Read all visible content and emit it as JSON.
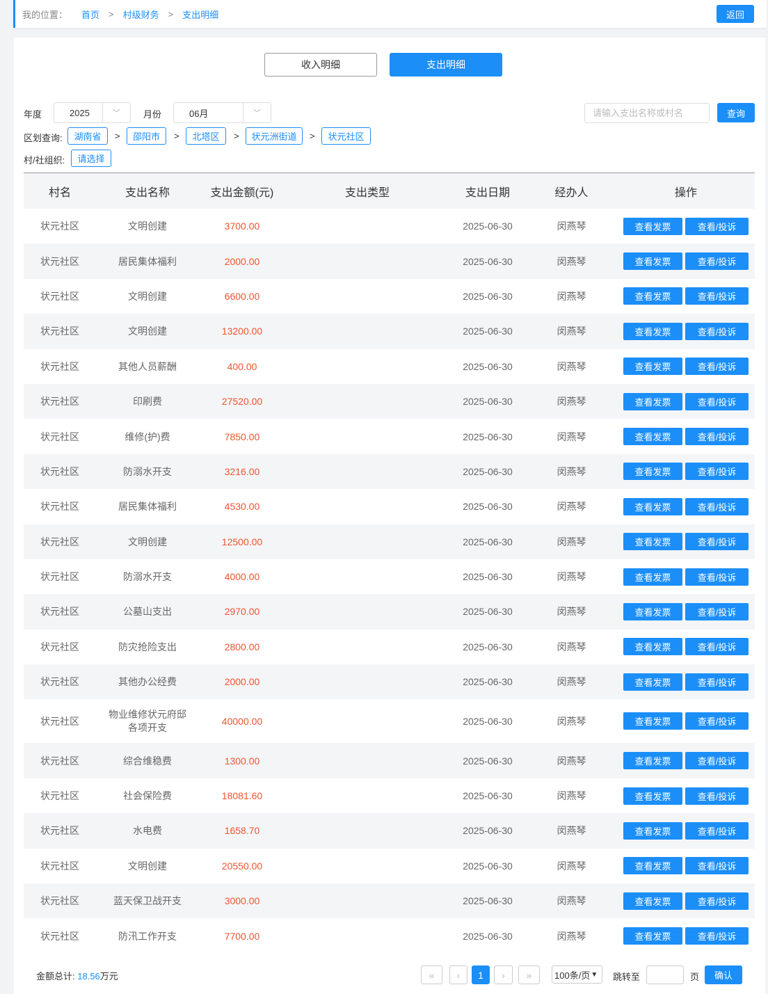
{
  "breadcrumb": {
    "label": "我的位置：",
    "home": "首页",
    "sep1": ">",
    "section": "村级财务",
    "sep2": ">",
    "current": "支出明细"
  },
  "back_label": "返回",
  "tabs": {
    "income": "收入明细",
    "expense": "支出明细"
  },
  "filters": {
    "year_label": "年度",
    "year_value": "2025",
    "month_label": "月份",
    "month_value": "06月",
    "search_placeholder": "请输入支出名称或村名",
    "query_label": "查询",
    "region_label": "区划查询:",
    "region_sep": ">",
    "region": [
      "湖南省",
      "邵阳市",
      "北塔区",
      "状元洲街道",
      "状元社区"
    ],
    "org_label": "村/社组织:",
    "org_value": "请选择"
  },
  "table": {
    "headers": [
      "村名",
      "支出名称",
      "支出金额(元)",
      "支出类型",
      "支出日期",
      "经办人",
      "操作"
    ],
    "action_invoice": "查看发票",
    "action_complain": "查看/投诉",
    "rows": [
      {
        "village": "状元社区",
        "name": "文明创建",
        "amount": "3700.00",
        "type": "",
        "date": "2025-06-30",
        "handler": "闵燕琴"
      },
      {
        "village": "状元社区",
        "name": "居民集体福利",
        "amount": "2000.00",
        "type": "",
        "date": "2025-06-30",
        "handler": "闵燕琴"
      },
      {
        "village": "状元社区",
        "name": "文明创建",
        "amount": "6600.00",
        "type": "",
        "date": "2025-06-30",
        "handler": "闵燕琴"
      },
      {
        "village": "状元社区",
        "name": "文明创建",
        "amount": "13200.00",
        "type": "",
        "date": "2025-06-30",
        "handler": "闵燕琴"
      },
      {
        "village": "状元社区",
        "name": "其他人员薪酬",
        "amount": "400.00",
        "type": "",
        "date": "2025-06-30",
        "handler": "闵燕琴"
      },
      {
        "village": "状元社区",
        "name": "印刷费",
        "amount": "27520.00",
        "type": "",
        "date": "2025-06-30",
        "handler": "闵燕琴"
      },
      {
        "village": "状元社区",
        "name": "维修(护)费",
        "amount": "7850.00",
        "type": "",
        "date": "2025-06-30",
        "handler": "闵燕琴"
      },
      {
        "village": "状元社区",
        "name": "防溺水开支",
        "amount": "3216.00",
        "type": "",
        "date": "2025-06-30",
        "handler": "闵燕琴"
      },
      {
        "village": "状元社区",
        "name": "居民集体福利",
        "amount": "4530.00",
        "type": "",
        "date": "2025-06-30",
        "handler": "闵燕琴"
      },
      {
        "village": "状元社区",
        "name": "文明创建",
        "amount": "12500.00",
        "type": "",
        "date": "2025-06-30",
        "handler": "闵燕琴"
      },
      {
        "village": "状元社区",
        "name": "防溺水开支",
        "amount": "4000.00",
        "type": "",
        "date": "2025-06-30",
        "handler": "闵燕琴"
      },
      {
        "village": "状元社区",
        "name": "公墓山支出",
        "amount": "2970.00",
        "type": "",
        "date": "2025-06-30",
        "handler": "闵燕琴"
      },
      {
        "village": "状元社区",
        "name": "防灾抢险支出",
        "amount": "2800.00",
        "type": "",
        "date": "2025-06-30",
        "handler": "闵燕琴"
      },
      {
        "village": "状元社区",
        "name": "其他办公经费",
        "amount": "2000.00",
        "type": "",
        "date": "2025-06-30",
        "handler": "闵燕琴"
      },
      {
        "village": "状元社区",
        "name": "物业维修状元府邸各项开支",
        "amount": "40000.00",
        "type": "",
        "date": "2025-06-30",
        "handler": "闵燕琴"
      },
      {
        "village": "状元社区",
        "name": "综合维稳费",
        "amount": "1300.00",
        "type": "",
        "date": "2025-06-30",
        "handler": "闵燕琴"
      },
      {
        "village": "状元社区",
        "name": "社会保险费",
        "amount": "18081.60",
        "type": "",
        "date": "2025-06-30",
        "handler": "闵燕琴"
      },
      {
        "village": "状元社区",
        "name": "水电费",
        "amount": "1658.70",
        "type": "",
        "date": "2025-06-30",
        "handler": "闵燕琴"
      },
      {
        "village": "状元社区",
        "name": "文明创建",
        "amount": "20550.00",
        "type": "",
        "date": "2025-06-30",
        "handler": "闵燕琴"
      },
      {
        "village": "状元社区",
        "name": "蓝天保卫战开支",
        "amount": "3000.00",
        "type": "",
        "date": "2025-06-30",
        "handler": "闵燕琴"
      },
      {
        "village": "状元社区",
        "name": "防汛工作开支",
        "amount": "7700.00",
        "type": "",
        "date": "2025-06-30",
        "handler": "闵燕琴"
      }
    ]
  },
  "footer": {
    "total_label": "金额总计:",
    "total_value": "18.56",
    "total_unit": "万元",
    "page_first": "«",
    "page_prev": "‹",
    "current_page": "1",
    "page_next": "›",
    "page_last": "»",
    "page_size": "100条/页",
    "jump_label": "跳转至",
    "page_unit": "页",
    "confirm_label": "确认"
  },
  "colors": {
    "accent": "#1b8ef8",
    "amount": "#f0542d"
  }
}
